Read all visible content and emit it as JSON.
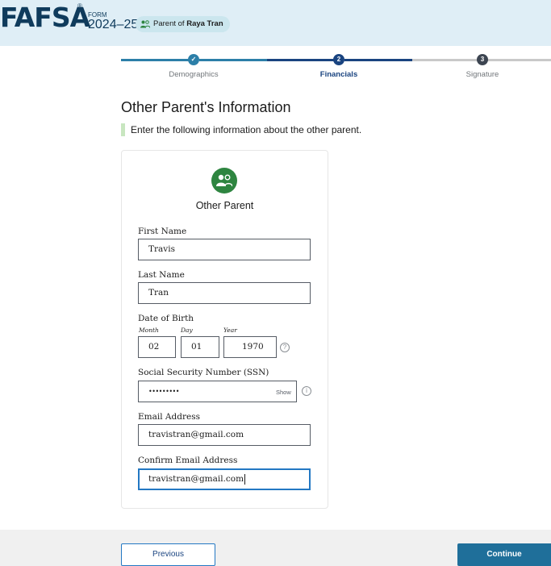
{
  "header": {
    "logo": "FAFSA",
    "logo_mark": "®",
    "form_label": "FORM",
    "form_year": "2024–25",
    "role_prefix": "Parent of",
    "role_name": "Raya Tran"
  },
  "stepper": {
    "steps": [
      {
        "number": "✓",
        "label": "Demographics",
        "status": "complete"
      },
      {
        "number": "2",
        "label": "Financials",
        "status": "current"
      },
      {
        "number": "3",
        "label": "Signature",
        "status": "upcoming"
      }
    ]
  },
  "page": {
    "title": "Other Parent's Information",
    "instruction": "Enter the following information about the other parent."
  },
  "card": {
    "title": "Other Parent",
    "avatar_icon": "people-icon"
  },
  "form": {
    "first_name": {
      "label": "First Name",
      "value": "Travis"
    },
    "last_name": {
      "label": "Last Name",
      "value": "Tran"
    },
    "dob": {
      "label": "Date of Birth",
      "month_label": "Month",
      "month_value": "02",
      "day_label": "Day",
      "day_value": "01",
      "year_label": "Year",
      "year_value": "1970",
      "help_icon": "question-circle-icon"
    },
    "ssn": {
      "label": "Social Security Number (SSN)",
      "value": "•••••••••",
      "show_label": "Show",
      "info_icon": "info-circle-icon"
    },
    "email": {
      "label": "Email Address",
      "value": "travistran@gmail.com"
    },
    "confirm_email": {
      "label": "Confirm Email Address",
      "value": "travistran@gmail.com"
    }
  },
  "footer": {
    "previous_label": "Previous",
    "continue_label": "Continue"
  },
  "colors": {
    "header_bg": "#dfeef6",
    "logo": "#0f3b5c",
    "step_active": "#2c7fa8",
    "step_dark": "#1a4480",
    "step_pending": "#c9c9c9",
    "avatar_green": "#2e8540",
    "continue_bg": "#1f6f9a",
    "focus_border": "#2378c3"
  }
}
